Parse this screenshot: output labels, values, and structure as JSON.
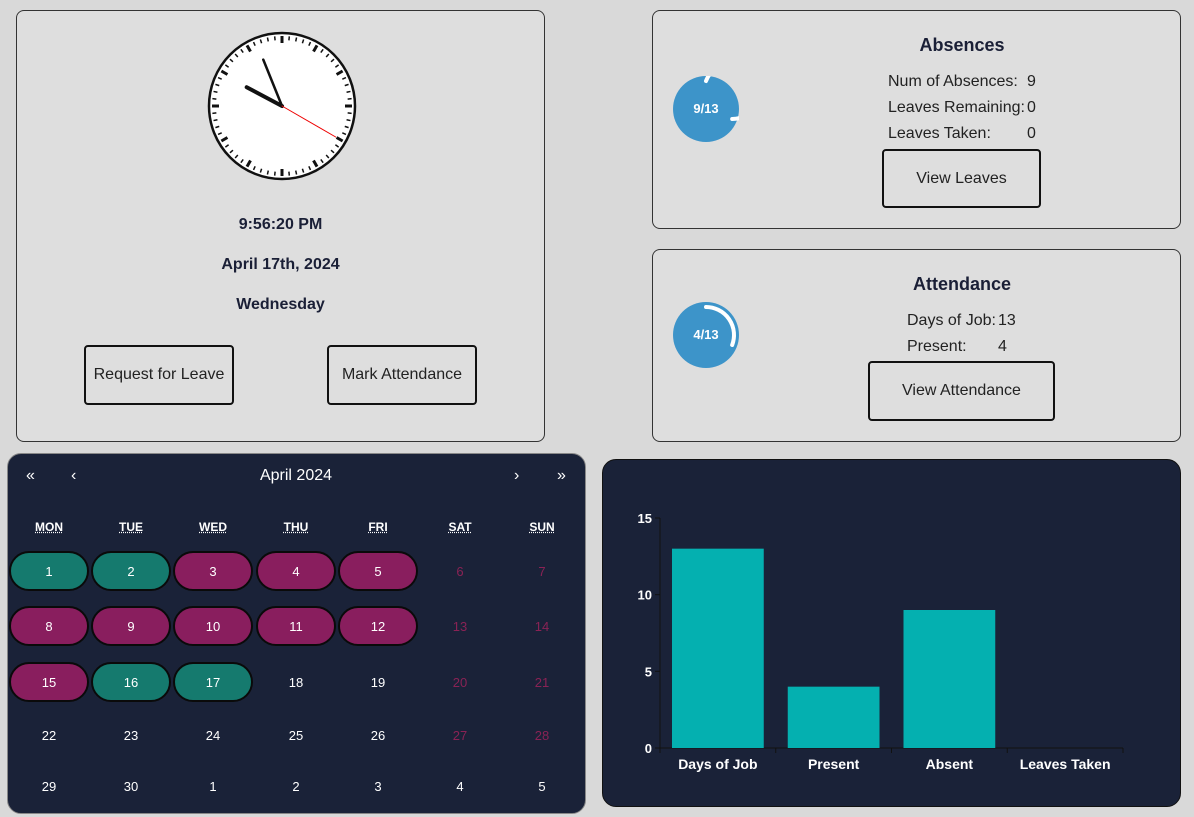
{
  "clock": {
    "time": "9:56:20 PM",
    "date": "April 17th, 2024",
    "weekday": "Wednesday",
    "request_leave_label": "Request for Leave",
    "mark_attendance_label": "Mark Attendance"
  },
  "absences": {
    "title": "Absences",
    "ring_label": "9/13",
    "ring_fraction": 0.692,
    "rows": [
      {
        "label": "Num of Absences:",
        "value": "9"
      },
      {
        "label": "Leaves Remaining:",
        "value": "0"
      },
      {
        "label": "Leaves Taken:",
        "value": "0"
      }
    ],
    "button_label": "View Leaves"
  },
  "attendance": {
    "title": "Attendance",
    "ring_label": "4/13",
    "ring_fraction": 0.308,
    "rows": [
      {
        "label": "Days of Job:",
        "value": "13"
      },
      {
        "label": "Present:",
        "value": "4"
      }
    ],
    "button_label": "View Attendance"
  },
  "calendar": {
    "title": "April 2024",
    "nav": {
      "prev_year": "«",
      "prev_month": "‹",
      "next_month": "›",
      "next_year": "»"
    },
    "weekdays": [
      "MON",
      "TUE",
      "WED",
      "THU",
      "FRI",
      "SAT",
      "SUN"
    ],
    "weeks": [
      [
        {
          "d": "1",
          "s": "green"
        },
        {
          "d": "2",
          "s": "green"
        },
        {
          "d": "3",
          "s": "purple"
        },
        {
          "d": "4",
          "s": "purple"
        },
        {
          "d": "5",
          "s": "purple"
        },
        {
          "d": "6",
          "s": "weekend"
        },
        {
          "d": "7",
          "s": "weekend"
        }
      ],
      [
        {
          "d": "8",
          "s": "purple"
        },
        {
          "d": "9",
          "s": "purple"
        },
        {
          "d": "10",
          "s": "purple"
        },
        {
          "d": "11",
          "s": "purple"
        },
        {
          "d": "12",
          "s": "purple"
        },
        {
          "d": "13",
          "s": "weekend"
        },
        {
          "d": "14",
          "s": "weekend"
        }
      ],
      [
        {
          "d": "15",
          "s": "purple"
        },
        {
          "d": "16",
          "s": "green"
        },
        {
          "d": "17",
          "s": "green"
        },
        {
          "d": "18",
          "s": ""
        },
        {
          "d": "19",
          "s": ""
        },
        {
          "d": "20",
          "s": "weekend"
        },
        {
          "d": "21",
          "s": "weekend"
        }
      ],
      [
        {
          "d": "22",
          "s": ""
        },
        {
          "d": "23",
          "s": ""
        },
        {
          "d": "24",
          "s": ""
        },
        {
          "d": "25",
          "s": ""
        },
        {
          "d": "26",
          "s": ""
        },
        {
          "d": "27",
          "s": "weekend"
        },
        {
          "d": "28",
          "s": "weekend"
        }
      ],
      [
        {
          "d": "29",
          "s": ""
        },
        {
          "d": "30",
          "s": ""
        },
        {
          "d": "1",
          "s": ""
        },
        {
          "d": "2",
          "s": ""
        },
        {
          "d": "3",
          "s": ""
        },
        {
          "d": "4",
          "s": ""
        },
        {
          "d": "5",
          "s": ""
        }
      ]
    ]
  },
  "colors": {
    "accent_ring": "#3d94c9",
    "present_green": "#157a6e",
    "absent_purple": "#891e5e",
    "bar_color": "#04b0b0",
    "dark_bg": "#1a2238"
  },
  "chart_data": {
    "type": "bar",
    "categories": [
      "Days of Job",
      "Present",
      "Absent",
      "Leaves Taken"
    ],
    "values": [
      13,
      4,
      9,
      0
    ],
    "ylim": [
      0,
      15
    ],
    "yticks": [
      0,
      5,
      10,
      15
    ],
    "grid": false
  }
}
